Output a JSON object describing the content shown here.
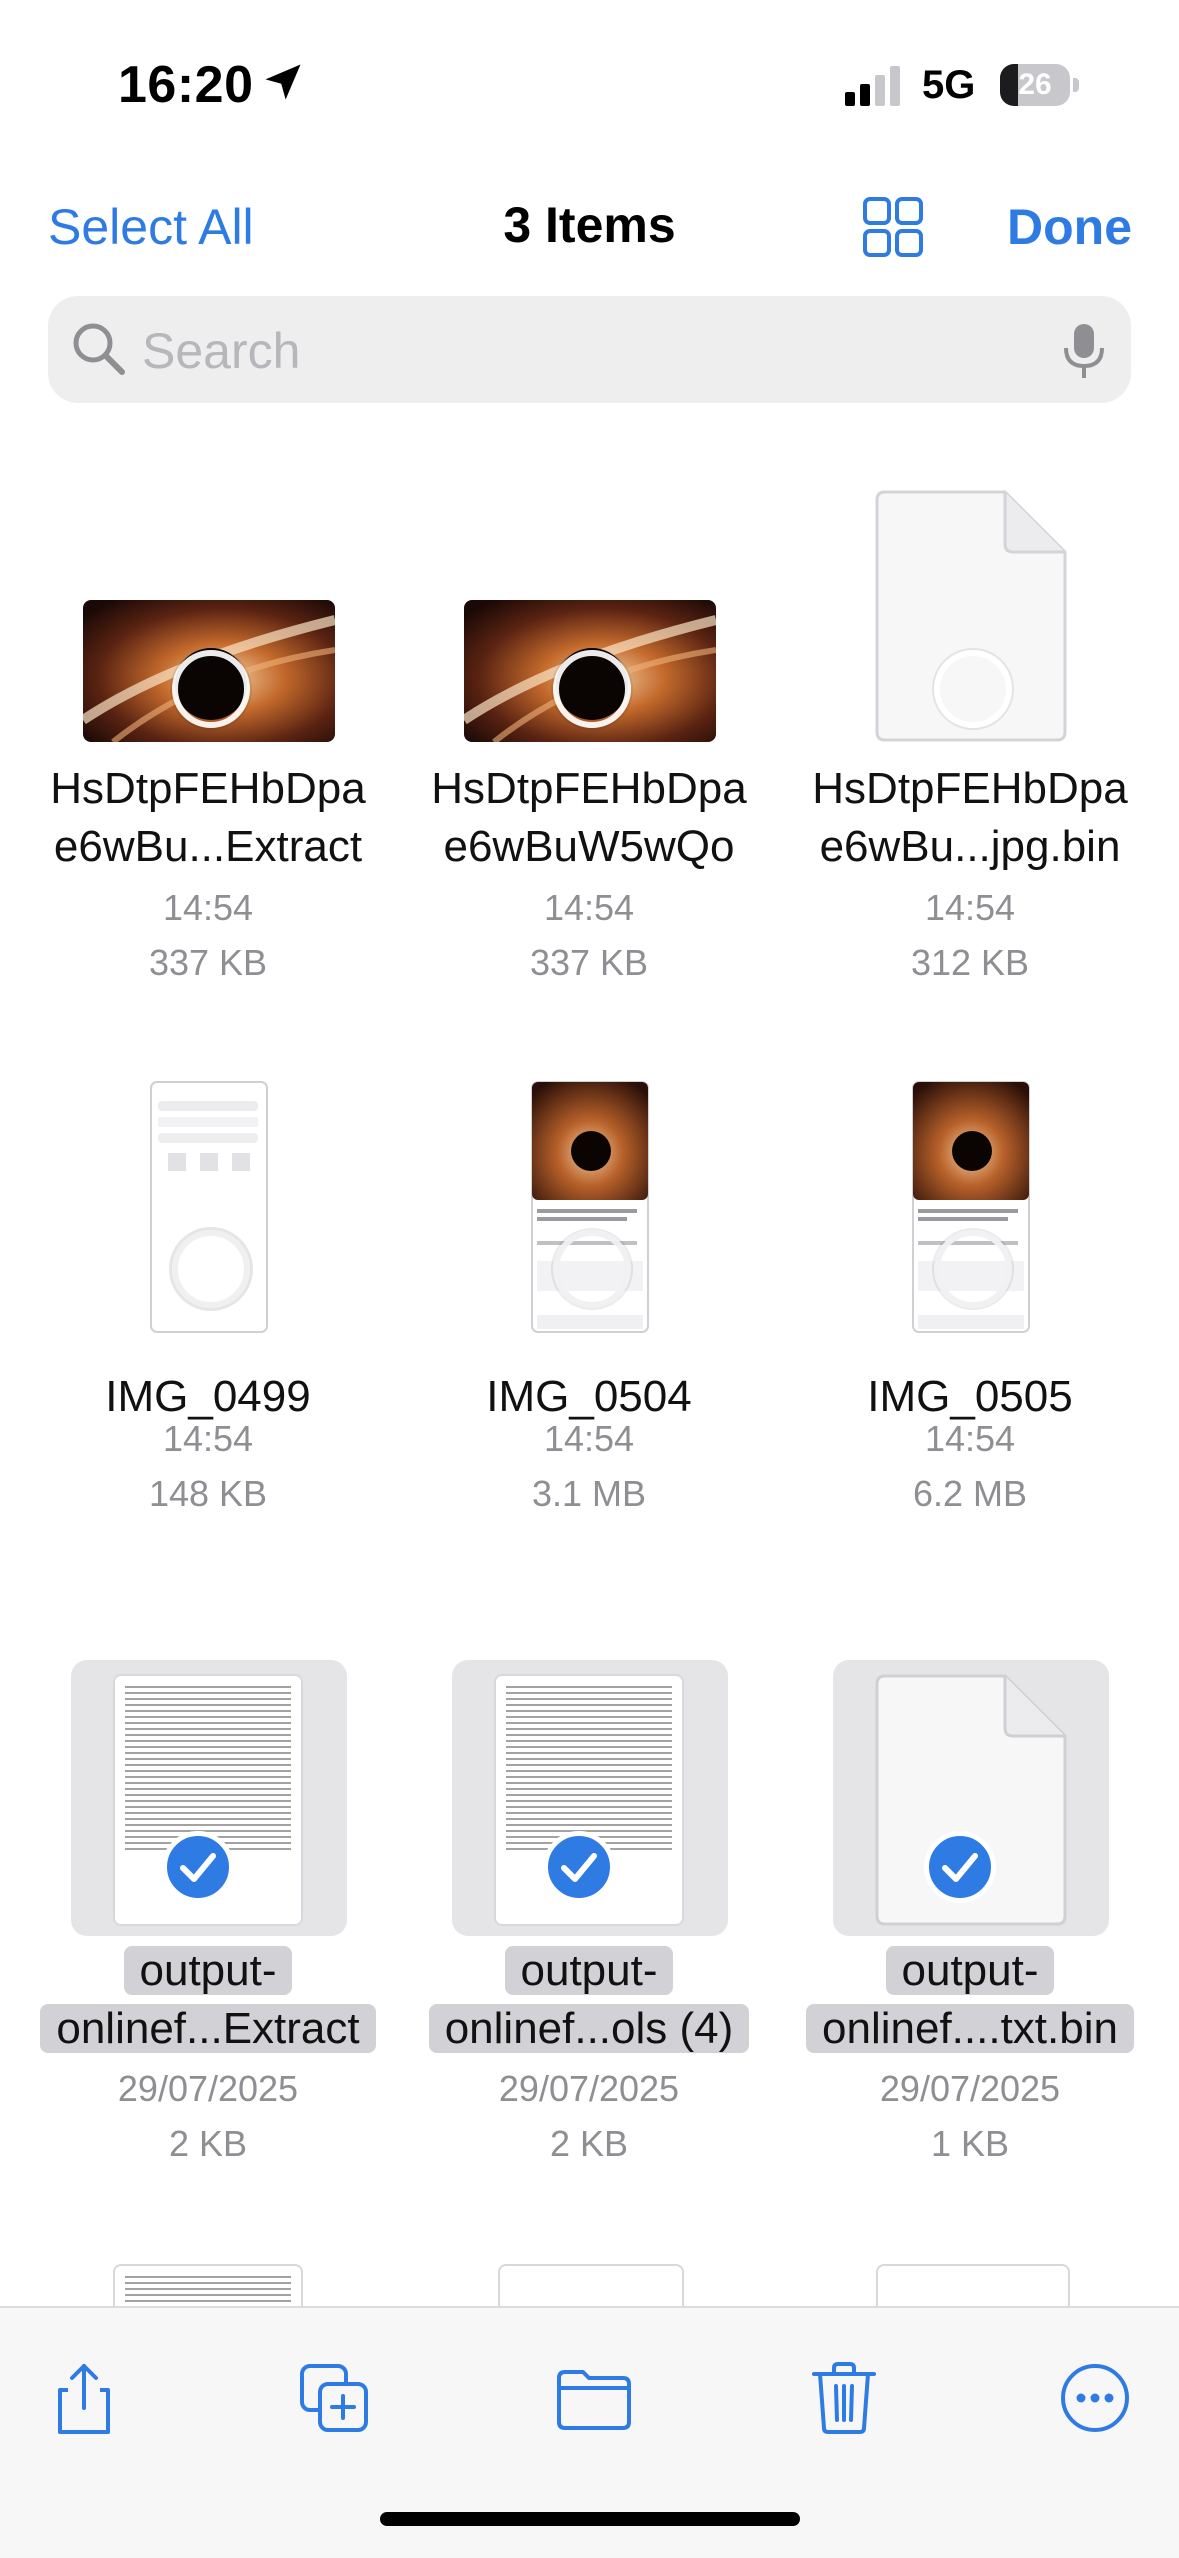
{
  "status": {
    "time": "16:20",
    "network": "5G",
    "battery": "26",
    "battery_level": 0.26
  },
  "nav": {
    "select_all": "Select All",
    "title": "3 Items",
    "done": "Done"
  },
  "search": {
    "placeholder": "Search",
    "value": ""
  },
  "colors": {
    "accent": "#2f7be4",
    "secondary_text": "#8e8e93",
    "selection_bg": "#e5e5e7"
  },
  "items": [
    {
      "line1": "HsDtpFEHbDpa",
      "line2": "e6wBu...Extract",
      "time": "14:54",
      "size": "337 KB",
      "selected": false,
      "kind": "image"
    },
    {
      "line1": "HsDtpFEHbDpa",
      "line2": "e6wBuW5wQo",
      "time": "14:54",
      "size": "337 KB",
      "selected": false,
      "kind": "image"
    },
    {
      "line1": "HsDtpFEHbDpa",
      "line2": "e6wBu...jpg.bin",
      "time": "14:54",
      "size": "312 KB",
      "selected": false,
      "kind": "blank-doc"
    },
    {
      "line1": "IMG_0499",
      "time": "14:54",
      "size": "148 KB",
      "selected": false,
      "kind": "screenshot"
    },
    {
      "line1": "IMG_0504",
      "time": "14:54",
      "size": "3.1 MB",
      "selected": false,
      "kind": "screenshot"
    },
    {
      "line1": "IMG_0505",
      "time": "14:54",
      "size": "6.2 MB",
      "selected": false,
      "kind": "screenshot"
    },
    {
      "line1": "output-",
      "line2": "onlinef...Extract",
      "date": "29/07/2025",
      "size": "2 KB",
      "selected": true,
      "kind": "text-doc"
    },
    {
      "line1": "output-",
      "line2": "onlinef...ols (4)",
      "date": "29/07/2025",
      "size": "2 KB",
      "selected": true,
      "kind": "text-doc"
    },
    {
      "line1": "output-",
      "line2": "onlinef....txt.bin",
      "date": "29/07/2025",
      "size": "1 KB",
      "selected": true,
      "kind": "blank-doc"
    }
  ],
  "toolbar": {
    "icons": [
      "share-icon",
      "duplicate-icon",
      "folder-icon",
      "trash-icon",
      "more-icon"
    ]
  }
}
